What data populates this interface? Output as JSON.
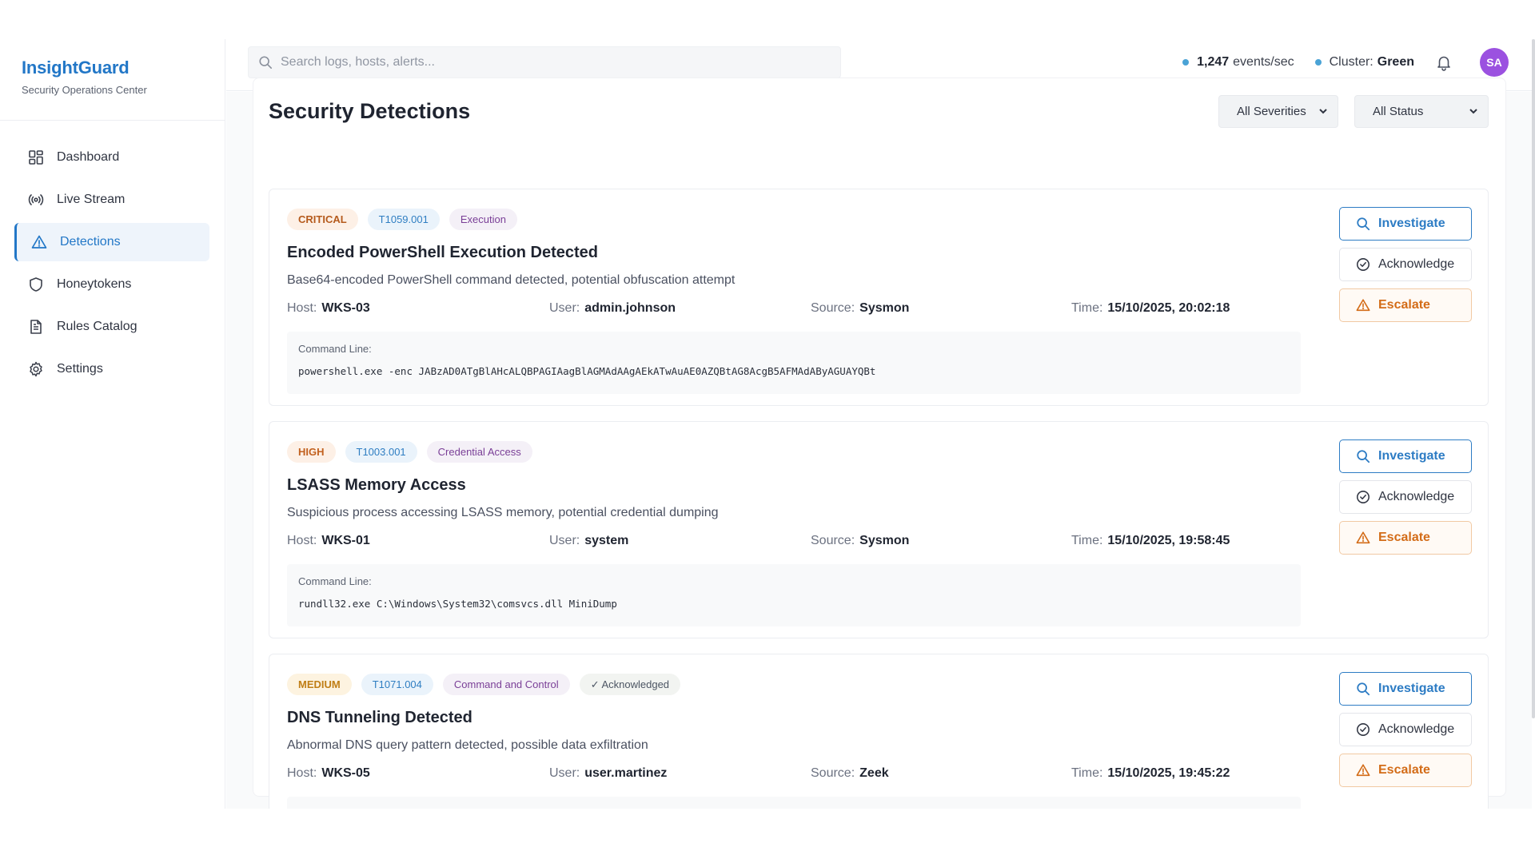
{
  "app": {
    "name": "InsightGuard",
    "subtitle": "Security Operations Center"
  },
  "nav": {
    "items": [
      {
        "label": "Dashboard",
        "icon": "dashboard-grid-icon"
      },
      {
        "label": "Live Stream",
        "icon": "broadcast-icon"
      },
      {
        "label": "Detections",
        "icon": "alert-triangle-icon",
        "active": true
      },
      {
        "label": "Honeytokens",
        "icon": "shield-icon"
      },
      {
        "label": "Rules Catalog",
        "icon": "document-icon"
      },
      {
        "label": "Settings",
        "icon": "gear-icon"
      }
    ]
  },
  "topbar": {
    "search_placeholder": "Search logs, hosts, alerts...",
    "events_rate": "1,247",
    "events_unit": "events/sec",
    "cluster_label": "Cluster:",
    "cluster_status": "Green",
    "avatar_initials": "SA"
  },
  "page": {
    "title": "Security Detections",
    "filters": {
      "severity": "All Severities",
      "status": "All Status"
    }
  },
  "labels": {
    "host": "Host:",
    "user": "User:",
    "source": "Source:",
    "time": "Time:",
    "command_line": "Command Line:",
    "investigate": "Investigate",
    "acknowledge": "Acknowledge",
    "escalate": "Escalate"
  },
  "detections": [
    {
      "severity": "CRITICAL",
      "technique": "T1059.001",
      "tactic": "Execution",
      "title": "Encoded PowerShell Execution Detected",
      "description": "Base64-encoded PowerShell command detected, potential obfuscation attempt",
      "host": "WKS-03",
      "user": "admin.johnson",
      "source": "Sysmon",
      "time": "15/10/2025, 20:02:18",
      "command": "powershell.exe -enc JABzAD0ATgBlAHcALQBPAGIAagBlAGMAdAAgAEkATwAuAE0AZQBtAG8AcgB5AFMAdAByAGUAYQBt"
    },
    {
      "severity": "HIGH",
      "technique": "T1003.001",
      "tactic": "Credential Access",
      "title": "LSASS Memory Access",
      "description": "Suspicious process accessing LSASS memory, potential credential dumping",
      "host": "WKS-01",
      "user": "system",
      "source": "Sysmon",
      "time": "15/10/2025, 19:58:45",
      "command": "rundll32.exe C:\\Windows\\System32\\comsvcs.dll MiniDump"
    },
    {
      "severity": "MEDIUM",
      "technique": "T1071.004",
      "tactic": "Command and Control",
      "status": "✓ Acknowledged",
      "title": "DNS Tunneling Detected",
      "description": "Abnormal DNS query pattern detected, possible data exfiltration",
      "host": "WKS-05",
      "user": "user.martinez",
      "source": "Zeek",
      "time": "15/10/2025, 19:45:22",
      "command": ""
    }
  ],
  "colors": {
    "brand": "#2277c7",
    "critical": "#b55a1c",
    "high": "#c2611f",
    "medium": "#c07e15",
    "technique": "#2f7ec2",
    "tactic": "#7a3f97",
    "escalate": "#d36c18",
    "avatar": "#9b51e0",
    "status_dot": "#4aa3d6"
  }
}
